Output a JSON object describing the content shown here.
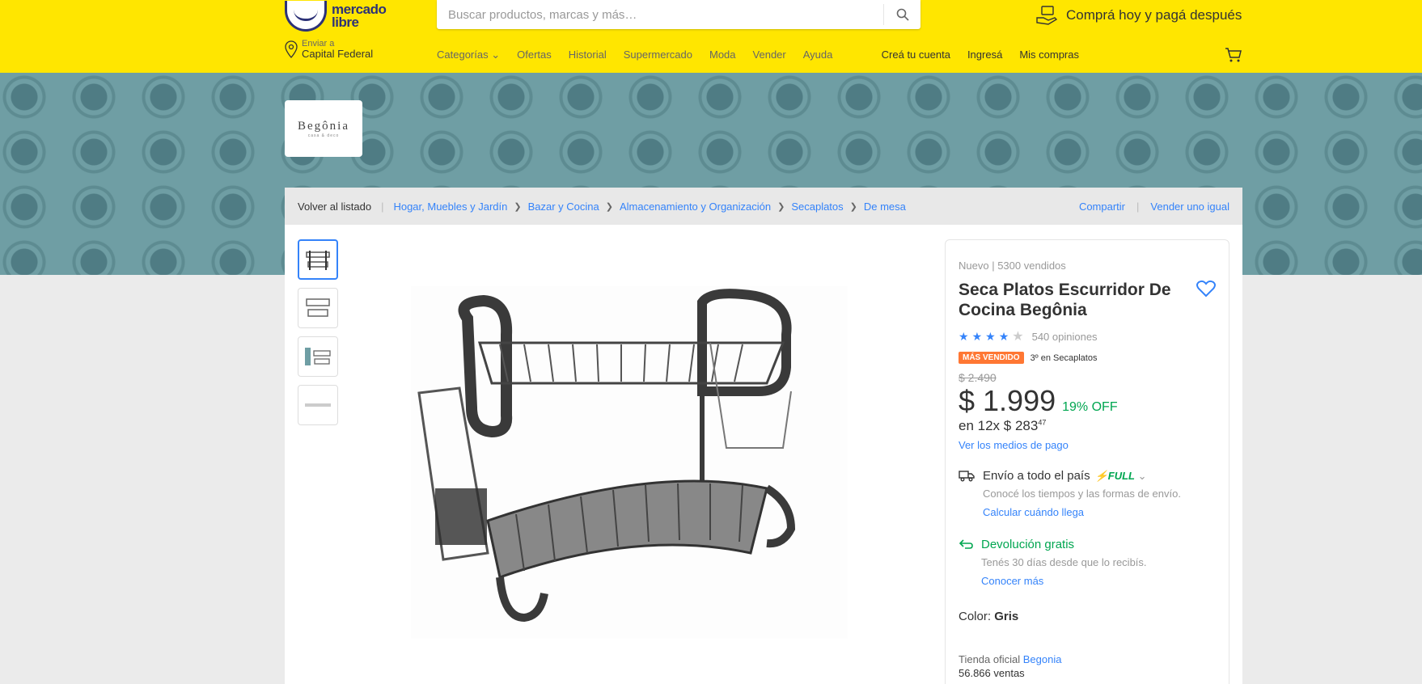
{
  "header": {
    "logo_line1": "mercado",
    "logo_line2": "libre",
    "search_placeholder": "Buscar productos, marcas y más…",
    "promo_text": "Comprá hoy y pagá después",
    "location_label": "Enviar a",
    "location_value": "Capital Federal",
    "nav": [
      "Categorías",
      "Ofertas",
      "Historial",
      "Supermercado",
      "Moda",
      "Vender",
      "Ayuda"
    ],
    "user_nav": [
      "Creá tu cuenta",
      "Ingresá",
      "Mis compras"
    ]
  },
  "store": {
    "logo_name": "Begônia",
    "logo_tag": "casa & deco"
  },
  "breadcrumb": {
    "back": "Volver al listado",
    "items": [
      "Hogar, Muebles y Jardín",
      "Bazar y Cocina",
      "Almacenamiento y Organización",
      "Secaplatos",
      "De mesa"
    ],
    "share": "Compartir",
    "sell": "Vender uno igual"
  },
  "product": {
    "condition": "Nuevo",
    "sold": "5300 vendidos",
    "title": "Seca Platos Escurridor De Cocina Begônia",
    "rating": 4,
    "rating_max": 5,
    "reviews": "540 opiniones",
    "badge": "MÁS VENDIDO",
    "rank": "3º en Secaplatos",
    "old_price": "$ 2.490",
    "price": "$ 1.999",
    "discount": "19% OFF",
    "installments_prefix": "en 12x $ 283",
    "installments_cents": "47",
    "payment_link": "Ver los medios de pago",
    "shipping": "Envío a todo el país",
    "shipping_badge": "FULL",
    "shipping_sub": "Conocé los tiempos y las formas de envío.",
    "shipping_link": "Calcular cuándo llega",
    "return_title": "Devolución gratis",
    "return_sub": "Tenés 30 días desde que lo recibís.",
    "return_link": "Conocer más",
    "color_label": "Color:",
    "color_value": "Gris",
    "store_label": "Tienda oficial",
    "store_name": "Begonia",
    "store_sales": "56.866 ventas"
  },
  "colors": {
    "brand_yellow": "#ffe600",
    "link_blue": "#3483fa",
    "success_green": "#00a650",
    "badge_orange": "#ff7733"
  }
}
